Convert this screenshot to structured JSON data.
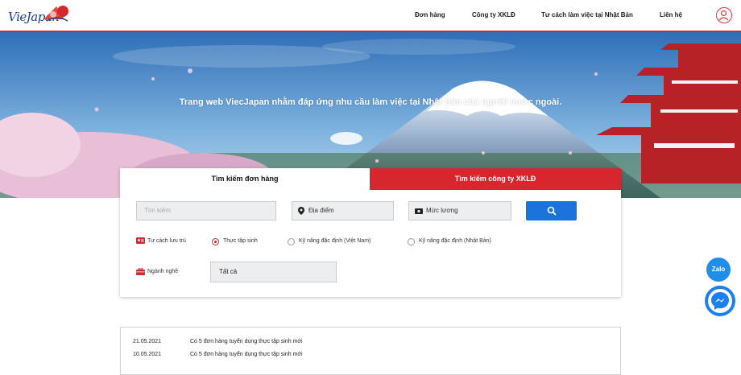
{
  "brand": {
    "logo_text": "VieJapan"
  },
  "nav": {
    "items": [
      {
        "label": "Đơn hàng"
      },
      {
        "label": "Công ty XKLĐ"
      },
      {
        "label": "Tư cách làm việc tại Nhật Bản"
      },
      {
        "label": "Liên hệ"
      }
    ],
    "user_icon": "user-circle-icon"
  },
  "hero": {
    "tagline": "Trang web ViecJapan nhằm đáp ứng nhu cầu làm việc tại Nhật Bản của người nước ngoài."
  },
  "search": {
    "tabs": [
      {
        "label": "Tìm kiếm đơn hàng",
        "active": true
      },
      {
        "label": "Tìm kiếm công ty XKLĐ",
        "active": false
      }
    ],
    "keyword_placeholder": "Tìm kiếm",
    "location_label": "Địa điểm",
    "salary_label": "Mức lương",
    "search_button_icon": "search-icon",
    "residence": {
      "label": "Tư cách lưu trú",
      "options": [
        {
          "label": "Thực tập sinh",
          "selected": true
        },
        {
          "label": "Kỹ năng đặc định (Việt Nam)",
          "selected": false
        },
        {
          "label": "Kỹ năng đặc định (Nhật Bản)",
          "selected": false
        }
      ]
    },
    "industry": {
      "label": "Ngành nghề",
      "value": "Tất cả"
    }
  },
  "news": [
    {
      "date": "21.05.2021",
      "text": "Có 5 đơn hàng tuyển dụng thực tập sinh mới"
    },
    {
      "date": "10.05.2021",
      "text": "Có 5 đơn hàng tuyển dụng thực tập sinh mới"
    }
  ],
  "floating": {
    "zalo_label": "Zalo",
    "messenger_icon": "messenger-icon"
  },
  "colors": {
    "brand_red": "#d8262f",
    "button_blue": "#1a73d8",
    "logo_blue": "#1b3f8e"
  }
}
